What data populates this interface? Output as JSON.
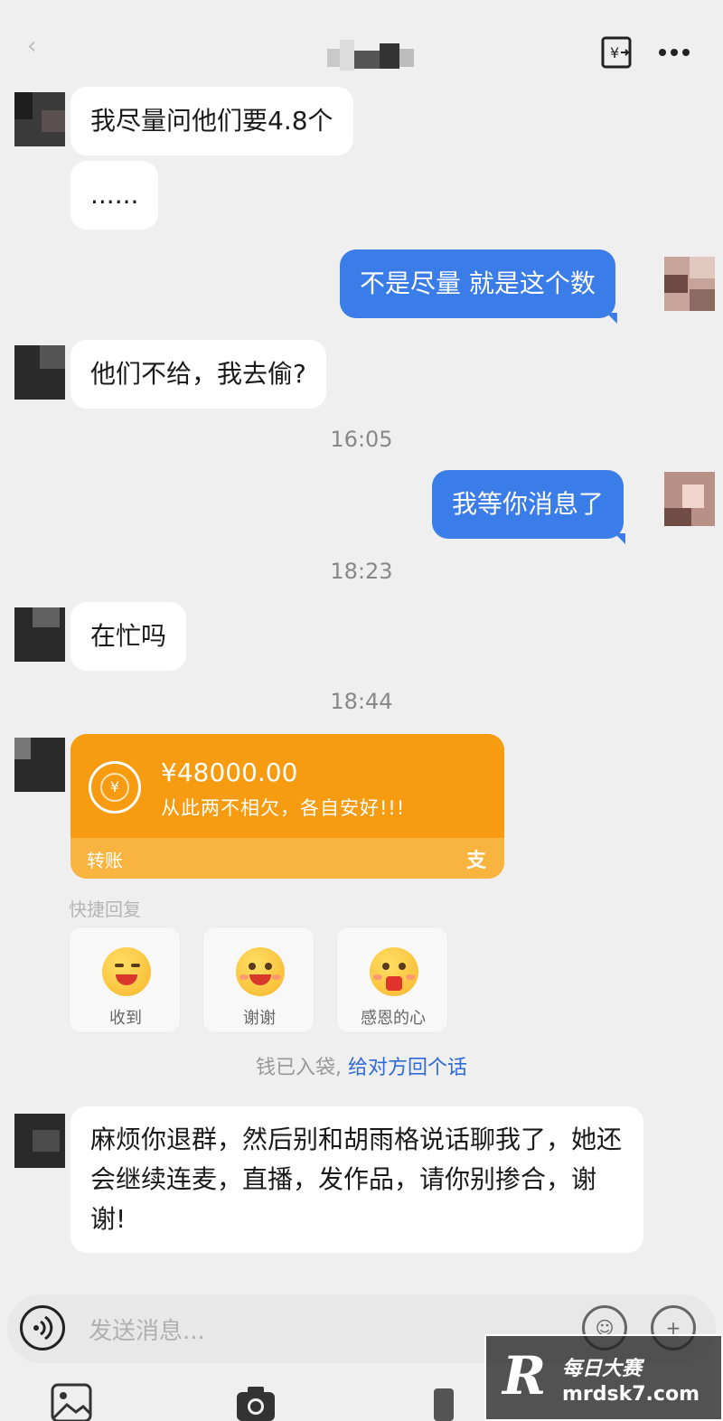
{
  "messages": {
    "m1": "我尽量问他们要4.8个",
    "m2": "......",
    "m3": "不是尽量 就是这个数",
    "m4": "他们不给，我去偷?",
    "m5": "我等你消息了",
    "m6": "在忙吗",
    "m7": "麻烦你退群，然后别和胡雨格说话聊我了，她还会继续连麦，直播，发作品，请你别掺合，谢谢!"
  },
  "timestamps": {
    "t1": "16:05",
    "t2": "18:23",
    "t3": "18:44"
  },
  "transfer": {
    "amount": "¥48000.00",
    "note": "从此两不相欠，各自安好!!!",
    "label": "转账",
    "brand": "支"
  },
  "quick_reply": {
    "title": "快捷回复",
    "options": [
      "收到",
      "谢谢",
      "感恩的心"
    ]
  },
  "hint": {
    "prefix": "钱已入袋,",
    "link": "给对方回个话"
  },
  "input": {
    "placeholder": "发送消息..."
  },
  "watermark": {
    "logo": "R",
    "line1": "每日大赛",
    "line2": "mrdsk7.com"
  },
  "colors": {
    "my_bubble": "#3b7de8",
    "transfer": "#f79b10",
    "link": "#2f6bd6"
  },
  "icons": [
    "back-icon",
    "transfer-yuan-icon",
    "more-icon",
    "voice-icon",
    "emoji-icon",
    "plus-icon",
    "image-icon",
    "camera-icon"
  ]
}
